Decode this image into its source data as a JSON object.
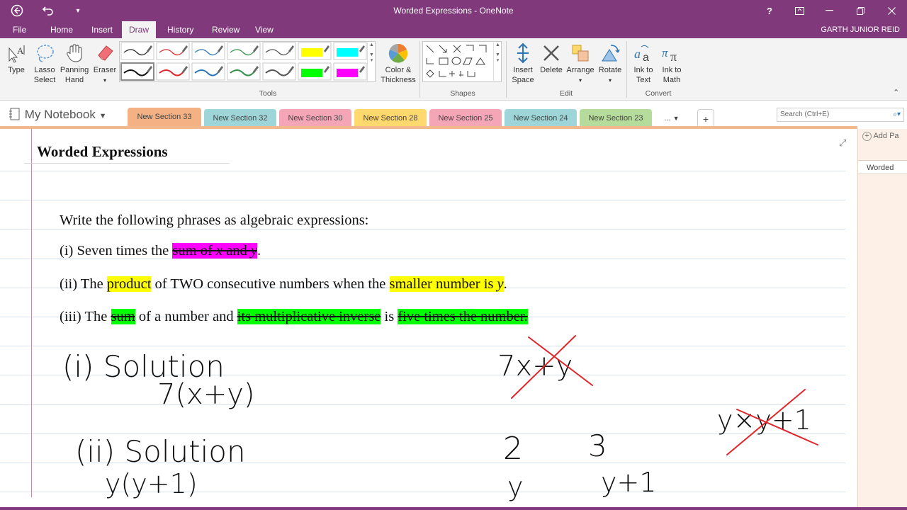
{
  "window": {
    "title": "Worded Expressions - OneNote",
    "help": "?",
    "user": "GARTH JUNIOR REID"
  },
  "menu": [
    "File",
    "Home",
    "Insert",
    "Draw",
    "History",
    "Review",
    "View"
  ],
  "ribbon": {
    "type": "Type",
    "lasso": [
      "Lasso",
      "Select"
    ],
    "panning": [
      "Panning",
      "Hand"
    ],
    "eraser": "Eraser",
    "color_thickness": [
      "Color &",
      "Thickness"
    ],
    "insert_space": [
      "Insert",
      "Space"
    ],
    "delete": "Delete",
    "arrange": "Arrange",
    "rotate": "Rotate",
    "ink_to_text": [
      "Ink to",
      "Text"
    ],
    "ink_to_math": [
      "Ink to",
      "Math"
    ],
    "groups": {
      "tools": "Tools",
      "shapes": "Shapes",
      "edit": "Edit",
      "convert": "Convert"
    }
  },
  "notebook": {
    "name": "My Notebook"
  },
  "sections": [
    {
      "label": "New Section 33",
      "color": "#f4b183"
    },
    {
      "label": "New Section 32",
      "color": "#9dd5d8"
    },
    {
      "label": "New Section 30",
      "color": "#f4a6b6"
    },
    {
      "label": "New Section 28",
      "color": "#ffd86e"
    },
    {
      "label": "New Section 25",
      "color": "#f4a6b6"
    },
    {
      "label": "New Section 24",
      "color": "#9dd5d8"
    },
    {
      "label": "New Section 23",
      "color": "#b6dc9b"
    }
  ],
  "sections_more": "...",
  "add_section": "+",
  "search_placeholder": "Search (Ctrl+E)",
  "pane": {
    "add_page": "Add Pa",
    "current_page": "Worded"
  },
  "page": {
    "title": "Worded Expressions",
    "instruction": "Write the following phrases as algebraic expressions:",
    "q1": {
      "prefix": "(i) Seven times the ",
      "hl_sum": "sum of ",
      "x": "x",
      "and": " and ",
      "y": "y",
      "end": "."
    },
    "q2": {
      "prefix": "(ii) The ",
      "hl_product": "product",
      "mid": " of TWO consecutive numbers when the ",
      "hl_smaller": "smaller number is  ",
      "y": "y",
      "end": "."
    },
    "q3": {
      "prefix": "(iii) The ",
      "hl_sum": "sum",
      "mid1": " of a number and ",
      "hl_inverse": "its multiplicative inverse",
      "mid2": " is ",
      "hl_five": "five times the number."
    }
  },
  "handwriting": {
    "sol1_heading": "(i) Solution",
    "sol1_answer": "7(x+y)",
    "scratch1": "7x+y",
    "sol2_heading": "(ii) Solution",
    "sol2_answer": "y(y+1)",
    "num_two": "2",
    "num_three": "3",
    "below_two": "y",
    "below_three": "y+1",
    "scratch2": "y×y+1"
  },
  "colors": {
    "accent": "#80397b",
    "highlight_magenta": "#ff00ff",
    "highlight_yellow": "#ffff00",
    "highlight_green": "#00ff00",
    "ink_red": "#e0262a"
  }
}
